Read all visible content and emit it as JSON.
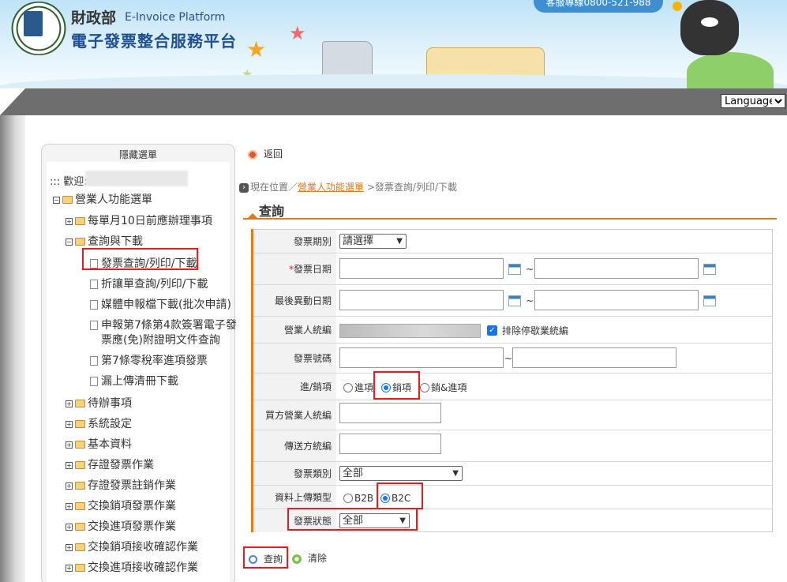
{
  "header": {
    "brand_cn": "財政部",
    "brand_en": "E-Invoice Platform",
    "brand_sub": "電子發票整合服務平台",
    "hotline": "客服專線0800-521-988",
    "language_label": "Language"
  },
  "sidebar": {
    "hide_label": "隱藏選單",
    "welcome": "::: 歡迎:",
    "root": "營業人功能選單",
    "items": [
      {
        "label": "每單月10日前應辦理事項",
        "type": "folder",
        "level": 1,
        "state": "collapsed"
      },
      {
        "label": "查詢與下載",
        "type": "folder",
        "level": 1,
        "state": "expanded"
      },
      {
        "label": "發票查詢/列印/下載",
        "type": "doc",
        "level": 2,
        "active": true
      },
      {
        "label": "折讓單查詢/列印/下載",
        "type": "doc",
        "level": 2
      },
      {
        "label": "媒體申報檔下載(批次申請)",
        "type": "doc",
        "level": 2
      },
      {
        "label": "申報第7條第4款簽署電子發",
        "label2": "票應(免)附證明文件查詢",
        "type": "doc",
        "level": 2
      },
      {
        "label": "第7條零稅率進項發票",
        "type": "doc",
        "level": 2
      },
      {
        "label": "漏上傳清冊下載",
        "type": "doc",
        "level": 2
      },
      {
        "label": "待辦事項",
        "type": "folder",
        "level": 1,
        "state": "collapsed"
      },
      {
        "label": "系統設定",
        "type": "folder",
        "level": 1,
        "state": "collapsed"
      },
      {
        "label": "基本資料",
        "type": "folder",
        "level": 1,
        "state": "collapsed"
      },
      {
        "label": "存證發票作業",
        "type": "folder",
        "level": 1,
        "state": "collapsed"
      },
      {
        "label": "存證發票註銷作業",
        "type": "folder",
        "level": 1,
        "state": "collapsed"
      },
      {
        "label": "交換銷項發票作業",
        "type": "folder",
        "level": 1,
        "state": "collapsed"
      },
      {
        "label": "交換進項發票作業",
        "type": "folder",
        "level": 1,
        "state": "collapsed"
      },
      {
        "label": "交換銷項接收確認作業",
        "type": "folder",
        "level": 1,
        "state": "collapsed"
      },
      {
        "label": "交換進項接收確認作業",
        "type": "folder",
        "level": 1,
        "state": "collapsed"
      }
    ]
  },
  "main": {
    "back_label": "返回",
    "breadcrumb": {
      "prefix": "現在位置／",
      "link": "營業人功能選單",
      "current": ">發票查詢/列印/下載"
    },
    "title": "查詢",
    "form": {
      "period_label": "發票期別",
      "period_value": "請選擇",
      "required_mark": "*",
      "date_label": "發票日期",
      "range_sep": "~",
      "change_date_label": "最後異動日期",
      "ban_label": "營業人統編",
      "exclude_label": "排除停歇業統編",
      "exclude_checked": true,
      "number_label": "發票號碼",
      "direction_label": "進/銷項",
      "direction_options": [
        "進項",
        "銷項",
        "銷&進項"
      ],
      "direction_selected": "銷項",
      "buyer_label": "買方營業人統編",
      "sender_label": "傳送方統編",
      "category_label": "發票類別",
      "category_value": "全部",
      "upload_type_label": "資料上傳類型",
      "upload_type_options": [
        "B2B",
        "B2C"
      ],
      "upload_type_selected": "B2C",
      "status_label": "發票狀態",
      "status_value": "全部"
    },
    "search_label": "查詢",
    "clear_label": "清除"
  }
}
